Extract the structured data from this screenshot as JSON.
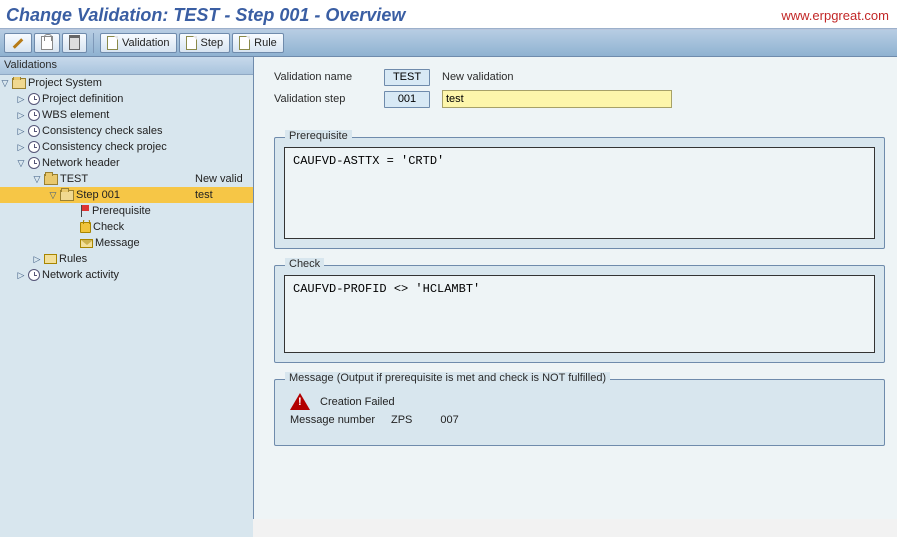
{
  "watermark": "www.erpgreat.com",
  "title": "Change Validation: TEST - Step 001 - Overview",
  "toolbar": {
    "validation": "Validation",
    "step": "Step",
    "rule": "Rule"
  },
  "sidebar": {
    "header": "Validations",
    "root": "Project System",
    "items": [
      "Project definition",
      "WBS element",
      "Consistency check sales",
      "Consistency check projec",
      "Network header"
    ],
    "test_name": "TEST",
    "test_desc": "New valid",
    "step_name": "Step 001",
    "step_desc": "test",
    "leaves": [
      "Prerequisite",
      "Check",
      "Message"
    ],
    "rules": "Rules",
    "last": "Network activity"
  },
  "fields": {
    "name_label": "Validation name",
    "name_value": "TEST",
    "name_desc": "New validation",
    "step_label": "Validation step",
    "step_value": "001",
    "step_input": "test"
  },
  "prereq": {
    "title": "Prerequisite",
    "code": "CAUFVD-ASTTX = 'CRTD'"
  },
  "check": {
    "title": "Check",
    "code": "CAUFVD-PROFID <> 'HCLAMBT'"
  },
  "message": {
    "title": "Message (Output if prerequisite is met and check is NOT fulfilled)",
    "text": "Creation Failed",
    "num_label": "Message number",
    "class": "ZPS",
    "num": "007"
  }
}
